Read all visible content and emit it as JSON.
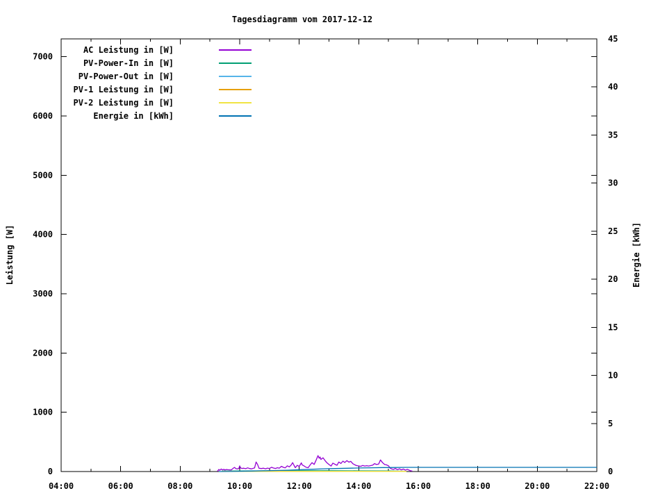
{
  "window": {
    "background": "#ffffff"
  },
  "chart": {
    "title": "Tagesdiagramm vom 2017-12-12",
    "y1_axis_title": "Leistung [W]",
    "y2_axis_title": "Energie [kWh]",
    "legend": [
      {
        "label": "AC Leistung in [W]",
        "color": "#9400d3"
      },
      {
        "label": "PV-Power-In in [W]",
        "color": "#009e73"
      },
      {
        "label": "PV-Power-Out in [W]",
        "color": "#56b4e9"
      },
      {
        "label": "PV-1 Leistung in [W]",
        "color": "#e69f00"
      },
      {
        "label": "PV-2 Leistung in [W]",
        "color": "#f0e442"
      },
      {
        "label": "Energie in [kWh]",
        "color": "#0072b2"
      }
    ]
  },
  "chart_data": {
    "type": "line",
    "title": "Tagesdiagramm vom 2017-12-12",
    "xlabel": "",
    "ylabel": "Leistung [W]",
    "y2label": "Energie [kWh]",
    "x_unit": "hour-of-day",
    "xlim": [
      4,
      22
    ],
    "x_major_ticks": [
      4,
      6,
      8,
      10,
      12,
      14,
      16,
      18,
      20,
      22
    ],
    "x_tick_labels": [
      "04:00",
      "06:00",
      "08:00",
      "10:00",
      "12:00",
      "14:00",
      "16:00",
      "18:00",
      "20:00",
      "22:00"
    ],
    "x_minor_ticks": [
      5,
      7,
      9,
      11,
      13,
      15,
      17,
      19,
      21
    ],
    "y1": {
      "lim": [
        0,
        7300
      ],
      "ticks": [
        0,
        1000,
        2000,
        3000,
        4000,
        5000,
        6000,
        7000
      ],
      "tick_labels": [
        "0",
        "1000",
        "2000",
        "3000",
        "4000",
        "5000",
        "6000",
        "7000"
      ]
    },
    "y2": {
      "lim": [
        0,
        45
      ],
      "ticks": [
        0,
        5,
        10,
        15,
        20,
        25,
        30,
        35,
        40,
        45
      ],
      "tick_labels": [
        "0",
        "5",
        "10",
        "15",
        "20",
        "25",
        "30",
        "35",
        "40",
        "45"
      ]
    },
    "grid": false,
    "legend_position": "top-left-inside",
    "series": [
      {
        "name": "AC Leistung in [W]",
        "axis": "y1",
        "color": "#9400d3",
        "points": [
          [
            9.25,
            4
          ],
          [
            9.3,
            35
          ],
          [
            9.33,
            20
          ],
          [
            9.38,
            42
          ],
          [
            9.42,
            28
          ],
          [
            9.47,
            38
          ],
          [
            9.5,
            26
          ],
          [
            9.55,
            34
          ],
          [
            9.6,
            30
          ],
          [
            9.67,
            28
          ],
          [
            9.72,
            28
          ],
          [
            9.78,
            55
          ],
          [
            9.83,
            70
          ],
          [
            9.87,
            48
          ],
          [
            9.92,
            44
          ],
          [
            9.97,
            52
          ],
          [
            10.0,
            95
          ],
          [
            10.03,
            60
          ],
          [
            10.08,
            52
          ],
          [
            10.13,
            56
          ],
          [
            10.2,
            48
          ],
          [
            10.27,
            62
          ],
          [
            10.33,
            50
          ],
          [
            10.4,
            44
          ],
          [
            10.47,
            58
          ],
          [
            10.5,
            60
          ],
          [
            10.55,
            160
          ],
          [
            10.6,
            120
          ],
          [
            10.65,
            55
          ],
          [
            10.73,
            50
          ],
          [
            10.8,
            56
          ],
          [
            10.87,
            46
          ],
          [
            10.93,
            58
          ],
          [
            11.0,
            52
          ],
          [
            11.07,
            72
          ],
          [
            11.13,
            60
          ],
          [
            11.2,
            52
          ],
          [
            11.27,
            64
          ],
          [
            11.33,
            56
          ],
          [
            11.4,
            88
          ],
          [
            11.47,
            70
          ],
          [
            11.53,
            62
          ],
          [
            11.6,
            96
          ],
          [
            11.67,
            78
          ],
          [
            11.73,
            110
          ],
          [
            11.78,
            150
          ],
          [
            11.83,
            100
          ],
          [
            11.87,
            64
          ],
          [
            11.93,
            104
          ],
          [
            12.0,
            86
          ],
          [
            12.07,
            146
          ],
          [
            12.1,
            112
          ],
          [
            12.17,
            92
          ],
          [
            12.23,
            72
          ],
          [
            12.3,
            64
          ],
          [
            12.37,
            112
          ],
          [
            12.43,
            150
          ],
          [
            12.5,
            120
          ],
          [
            12.57,
            196
          ],
          [
            12.63,
            268
          ],
          [
            12.67,
            224
          ],
          [
            12.7,
            246
          ],
          [
            12.73,
            204
          ],
          [
            12.8,
            232
          ],
          [
            12.87,
            184
          ],
          [
            12.93,
            148
          ],
          [
            13.0,
            118
          ],
          [
            13.07,
            92
          ],
          [
            13.13,
            142
          ],
          [
            13.2,
            122
          ],
          [
            13.27,
            106
          ],
          [
            13.33,
            160
          ],
          [
            13.4,
            136
          ],
          [
            13.47,
            176
          ],
          [
            13.53,
            152
          ],
          [
            13.6,
            184
          ],
          [
            13.67,
            158
          ],
          [
            13.73,
            172
          ],
          [
            13.8,
            132
          ],
          [
            13.87,
            112
          ],
          [
            13.93,
            100
          ],
          [
            14.0,
            94
          ],
          [
            14.07,
            88
          ],
          [
            14.13,
            102
          ],
          [
            14.2,
            92
          ],
          [
            14.27,
            98
          ],
          [
            14.33,
            92
          ],
          [
            14.4,
            100
          ],
          [
            14.47,
            108
          ],
          [
            14.53,
            134
          ],
          [
            14.6,
            118
          ],
          [
            14.67,
            126
          ],
          [
            14.73,
            196
          ],
          [
            14.8,
            150
          ],
          [
            14.87,
            118
          ],
          [
            14.93,
            112
          ],
          [
            15.0,
            96
          ],
          [
            15.05,
            60
          ],
          [
            15.1,
            44
          ],
          [
            15.17,
            36
          ],
          [
            15.23,
            52
          ],
          [
            15.3,
            32
          ],
          [
            15.37,
            46
          ],
          [
            15.43,
            28
          ],
          [
            15.5,
            42
          ],
          [
            15.57,
            24
          ],
          [
            15.63,
            38
          ],
          [
            15.7,
            22
          ],
          [
            15.75,
            12
          ],
          [
            15.8,
            8
          ]
        ]
      },
      {
        "name": "PV-Power-In in [W]",
        "axis": "y1",
        "color": "#009e73",
        "points": [
          [
            9.4,
            8
          ],
          [
            10.0,
            10
          ],
          [
            11.0,
            12
          ],
          [
            12.0,
            14
          ],
          [
            13.0,
            14
          ],
          [
            14.0,
            12
          ],
          [
            15.0,
            10
          ],
          [
            15.6,
            5
          ]
        ]
      },
      {
        "name": "PV-Power-Out in [W]",
        "axis": "y1",
        "color": "#56b4e9",
        "points": [
          [
            9.4,
            4
          ],
          [
            12.0,
            6
          ],
          [
            15.6,
            3
          ]
        ]
      },
      {
        "name": "PV-1 Leistung in [W]",
        "axis": "y1",
        "color": "#e69f00",
        "points": [
          [
            9.4,
            3
          ],
          [
            12.0,
            4
          ],
          [
            15.6,
            2
          ]
        ]
      },
      {
        "name": "PV-2 Leistung in [W]",
        "axis": "y1",
        "color": "#f0e442",
        "points": [
          [
            9.4,
            2
          ],
          [
            12.0,
            3
          ],
          [
            15.6,
            1
          ]
        ]
      },
      {
        "name": "Energie in [kWh]",
        "axis": "y2",
        "color": "#0072b2",
        "points": [
          [
            9.3,
            0
          ],
          [
            9.7,
            0.01
          ],
          [
            10.0,
            0.03
          ],
          [
            10.4,
            0.05
          ],
          [
            10.8,
            0.08
          ],
          [
            11.2,
            0.11
          ],
          [
            11.6,
            0.14
          ],
          [
            12.0,
            0.19
          ],
          [
            12.4,
            0.23
          ],
          [
            12.8,
            0.28
          ],
          [
            13.2,
            0.31
          ],
          [
            13.6,
            0.34
          ],
          [
            14.0,
            0.37
          ],
          [
            14.4,
            0.39
          ],
          [
            14.8,
            0.41
          ],
          [
            15.2,
            0.42
          ],
          [
            15.6,
            0.43
          ],
          [
            22.0,
            0.43
          ]
        ]
      }
    ]
  }
}
